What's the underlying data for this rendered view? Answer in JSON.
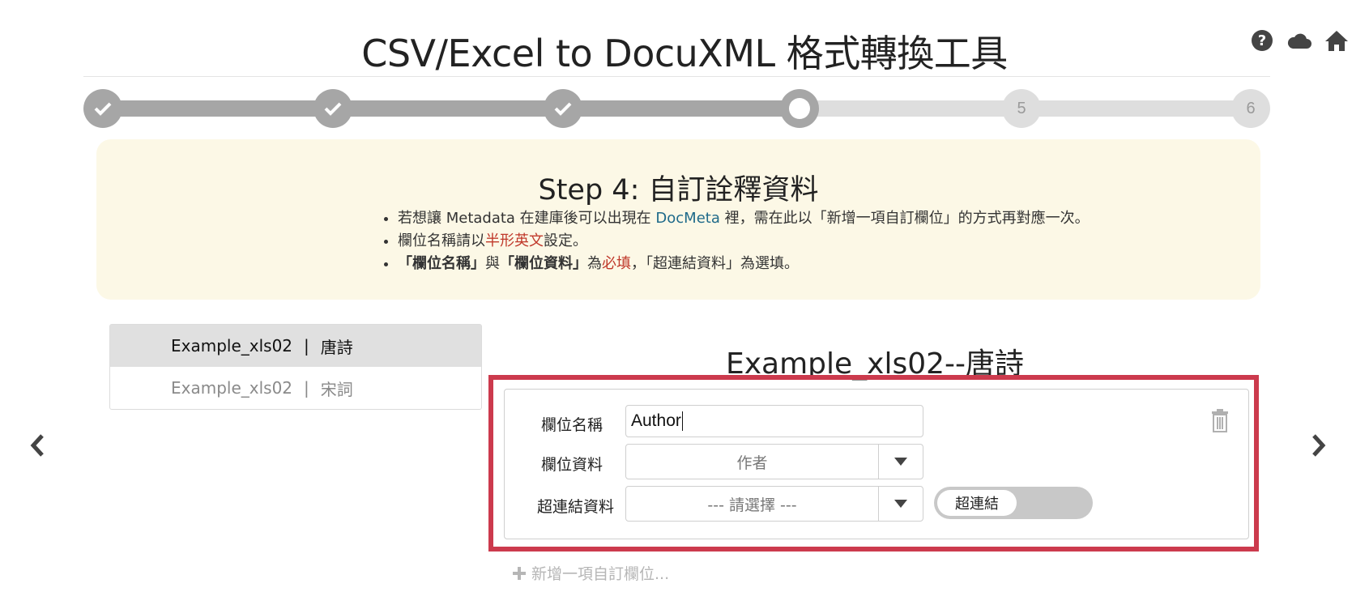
{
  "header": {
    "title": "CSV/Excel to DocuXML 格式轉換工具",
    "icons": [
      "help-circle-icon",
      "cloud-icon",
      "home-icon"
    ]
  },
  "stepper": {
    "steps": [
      {
        "number": "1",
        "state": "done"
      },
      {
        "number": "2",
        "state": "done"
      },
      {
        "number": "3",
        "state": "done"
      },
      {
        "number": "4",
        "state": "active"
      },
      {
        "number": "5",
        "state": "todo"
      },
      {
        "number": "6",
        "state": "todo"
      }
    ],
    "current_step": 4,
    "total_steps": 6
  },
  "info": {
    "heading": "Step 4: 自訂詮釋資料",
    "b1": {
      "a": "若想讓 Metadata 在建庫後可以出現在 ",
      "b": "DocMeta",
      "c": " 裡，需在此以「新增一項自訂欄位」的方式再對應一次。"
    },
    "b2": {
      "a": "欄位名稱請以",
      "b": "半形英文",
      "c": "設定。"
    },
    "b3": {
      "a": "「欄位名稱」",
      "b": "與",
      "c": "「欄位資料」",
      "d": "為",
      "e": "必填",
      "f": "，「超連結資料」為選填。"
    }
  },
  "files": [
    {
      "name": "Example_xls02",
      "sep": "|",
      "sheet": "唐詩",
      "selected": true
    },
    {
      "name": "Example_xls02",
      "sep": "|",
      "sheet": "宋詞",
      "selected": false
    }
  ],
  "editor": {
    "sheet_title": "Example_xls02--唐詩",
    "field_name_label": "欄位名稱",
    "field_name_value": "Author",
    "field_data_label": "欄位資料",
    "field_data_value": "作者",
    "link_data_label": "超連結資料",
    "link_data_value": "--- 請選擇 ---",
    "link_toggle_label": "超連結",
    "add_field_label": "新增一項自訂欄位..."
  },
  "colors": {
    "highlight": "#cc3a4d",
    "info_bg": "#fcf8e6",
    "step_done": "#a6a6a6",
    "step_todo": "#dedede",
    "link_blue": "#1f6a8a",
    "required_red": "#c0392b"
  }
}
